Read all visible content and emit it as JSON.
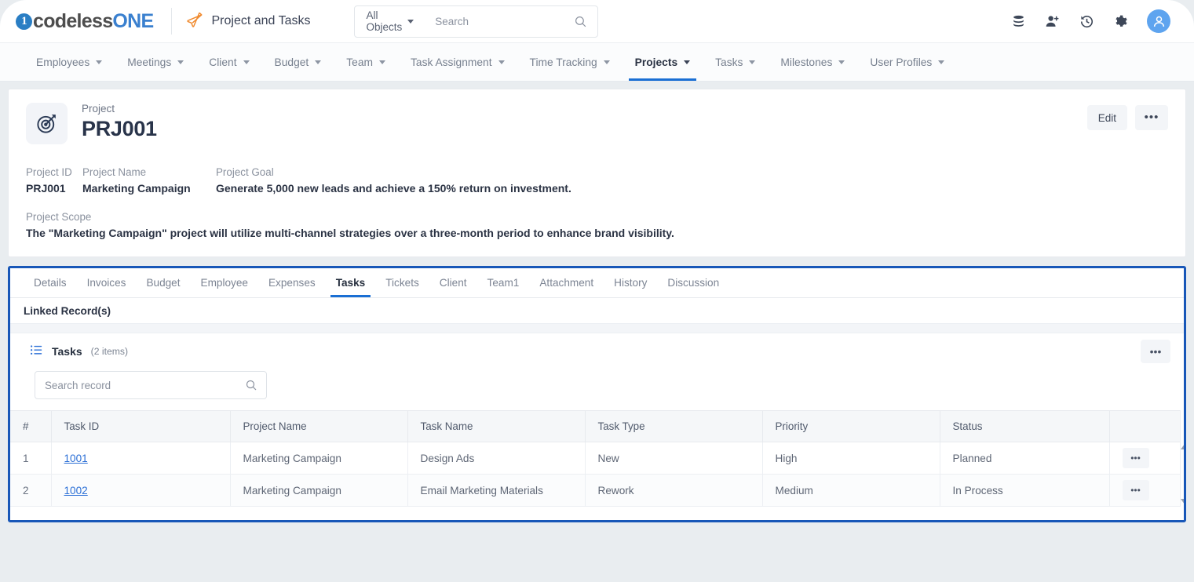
{
  "brand": {
    "logo_mark": "1",
    "logo_part1": "codeless",
    "logo_part2": "ONE",
    "app_title": "Project and Tasks"
  },
  "header": {
    "object_filter": "All Objects",
    "search_placeholder": "Search",
    "search_value": "",
    "icons": [
      "database-icon",
      "add-user-icon",
      "history-icon",
      "gear-icon",
      "user-avatar"
    ]
  },
  "nav": {
    "items": [
      {
        "label": "Employees",
        "active": false
      },
      {
        "label": "Meetings",
        "active": false
      },
      {
        "label": "Client",
        "active": false
      },
      {
        "label": "Budget",
        "active": false
      },
      {
        "label": "Team",
        "active": false
      },
      {
        "label": "Task Assignment",
        "active": false
      },
      {
        "label": "Time Tracking",
        "active": false
      },
      {
        "label": "Projects",
        "active": true
      },
      {
        "label": "Tasks",
        "active": false
      },
      {
        "label": "Milestones",
        "active": false
      },
      {
        "label": "User Profiles",
        "active": false
      }
    ]
  },
  "record": {
    "kind": "Project",
    "id": "PRJ001",
    "icon": "target-icon",
    "edit_label": "Edit",
    "more_label": "•••",
    "fields": [
      {
        "label": "Project ID",
        "value": "PRJ001"
      },
      {
        "label": "Project Name",
        "value": "Marketing Campaign"
      },
      {
        "label": "Project Goal",
        "value": "Generate 5,000 new leads and achieve a 150% return on investment."
      }
    ],
    "scope_label": "Project Scope",
    "scope_value": "The \"Marketing Campaign\" project will utilize multi-channel strategies over a three-month period to enhance brand visibility."
  },
  "tabs": [
    {
      "label": "Details",
      "active": false
    },
    {
      "label": "Invoices",
      "active": false
    },
    {
      "label": "Budget",
      "active": false
    },
    {
      "label": "Employee",
      "active": false
    },
    {
      "label": "Expenses",
      "active": false
    },
    {
      "label": "Tasks",
      "active": true
    },
    {
      "label": "Tickets",
      "active": false
    },
    {
      "label": "Client",
      "active": false
    },
    {
      "label": "Team1",
      "active": false
    },
    {
      "label": "Attachment",
      "active": false
    },
    {
      "label": "History",
      "active": false
    },
    {
      "label": "Discussion",
      "active": false
    }
  ],
  "linked": {
    "section_title": "Linked Record(s)",
    "list_title": "Tasks",
    "list_count": "(2 items)",
    "list_icon": "list-icon",
    "more_label": "•••",
    "search_placeholder": "Search record",
    "search_value": ""
  },
  "table": {
    "columns": [
      "#",
      "Task ID",
      "Project Name",
      "Task Name",
      "Task Type",
      "Priority",
      "Status",
      ""
    ],
    "rows": [
      {
        "index": "1",
        "task_id": "1001",
        "project_name": "Marketing Campaign",
        "task_name": "Design Ads",
        "task_type": "New",
        "priority": "High",
        "status": "Planned",
        "action": "•••"
      },
      {
        "index": "2",
        "task_id": "1002",
        "project_name": "Marketing Campaign",
        "task_name": "Email Marketing Materials",
        "task_type": "Rework",
        "priority": "Medium",
        "status": "In Process",
        "action": "•••"
      }
    ]
  },
  "colors": {
    "accent_blue": "#1a6fd4",
    "highlight_border": "#1857b8",
    "link_blue": "#2b6fd6",
    "page_bg": "#e9edf0"
  }
}
